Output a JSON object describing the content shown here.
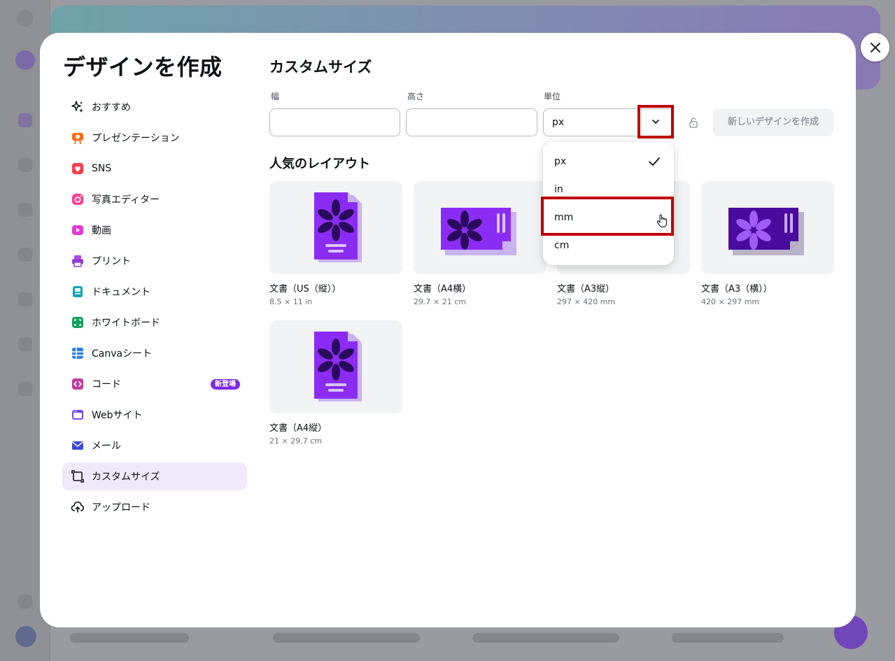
{
  "modal": {
    "title": "デザインを作成"
  },
  "sidebar": {
    "items": [
      {
        "label": "おすすめ",
        "icon": "sparkle-icon"
      },
      {
        "label": "プレゼンテーション",
        "icon": "presentation-icon"
      },
      {
        "label": "SNS",
        "icon": "heart-icon"
      },
      {
        "label": "写真エディター",
        "icon": "camera-icon"
      },
      {
        "label": "動画",
        "icon": "video-icon"
      },
      {
        "label": "プリント",
        "icon": "printer-icon"
      },
      {
        "label": "ドキュメント",
        "icon": "document-icon"
      },
      {
        "label": "ホワイトボード",
        "icon": "whiteboard-icon"
      },
      {
        "label": "Canvaシート",
        "icon": "sheet-icon"
      },
      {
        "label": "コード",
        "icon": "code-icon",
        "badge": "新登場"
      },
      {
        "label": "Webサイト",
        "icon": "website-icon"
      },
      {
        "label": "メール",
        "icon": "mail-icon"
      },
      {
        "label": "カスタムサイズ",
        "icon": "custom-size-icon",
        "active": true
      },
      {
        "label": "アップロード",
        "icon": "upload-cloud-icon"
      }
    ]
  },
  "custom_size": {
    "title": "カスタムサイズ",
    "width_label": "幅",
    "height_label": "高さ",
    "unit_label": "単位",
    "width_value": "",
    "height_value": "",
    "unit_value": "px",
    "create_button": "新しいデザインを作成"
  },
  "unit_dropdown": {
    "options": [
      {
        "label": "px",
        "selected": true
      },
      {
        "label": "in"
      },
      {
        "label": "mm",
        "hovered": true
      },
      {
        "label": "cm"
      }
    ]
  },
  "popular": {
    "title": "人気のレイアウト",
    "cards": [
      {
        "title": "文書（US（縦））",
        "size": "8.5 × 11 in",
        "orientation": "portrait"
      },
      {
        "title": "文書（A4横）",
        "size": "29.7 × 21 cm",
        "orientation": "landscape"
      },
      {
        "title": "文書（A3縦）",
        "size": "297 × 420 mm",
        "orientation": "portrait"
      },
      {
        "title": "文書（A3（横））",
        "size": "420 × 297 mm",
        "orientation": "landscape-dark"
      },
      {
        "title": "文書（A4縦）",
        "size": "21 × 29.7 cm",
        "orientation": "portrait"
      }
    ]
  },
  "colors": {
    "accent": "#7d2ae8",
    "highlight": "#c00000",
    "active_bg": "#efe9fb"
  }
}
